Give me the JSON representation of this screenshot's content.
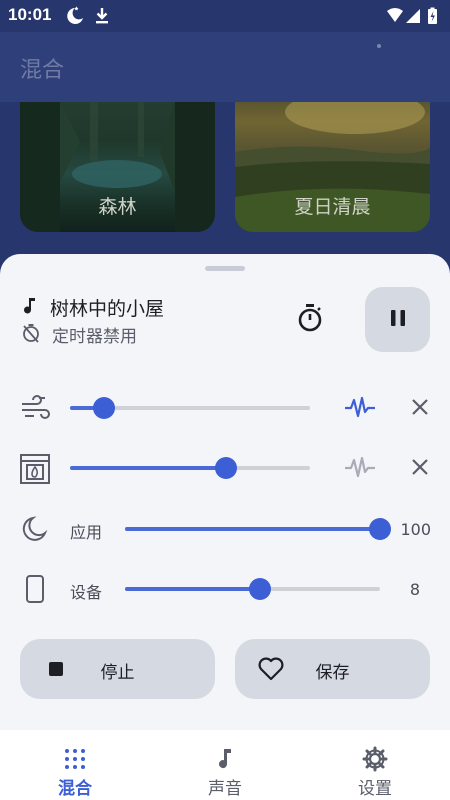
{
  "status_bar": {
    "time": "10:01",
    "icons": [
      "moon-icon",
      "download-icon",
      "wifi-icon",
      "signal-icon",
      "battery-charging-icon"
    ]
  },
  "app_bar": {
    "title": "混合"
  },
  "sound_cards": [
    {
      "label": "森林"
    },
    {
      "label": "夏日清晨"
    }
  ],
  "now_playing": {
    "title": "树林中的小屋",
    "timer_status": "定时器禁用",
    "icons": {
      "note": "music-note-icon",
      "timer_off": "timer-off-icon",
      "stopwatch": "stopwatch-icon",
      "pause": "pause-icon"
    }
  },
  "sound_mixers": [
    {
      "name": "wind",
      "icon": "wind-icon",
      "level": 0.14,
      "wave_active": true
    },
    {
      "name": "fireplace",
      "icon": "fireplace-icon",
      "level": 0.65,
      "wave_active": false
    }
  ],
  "volume_controls": [
    {
      "label": "应用",
      "icon": "moon-icon",
      "value": "100",
      "level": 1.0
    },
    {
      "label": "设备",
      "icon": "phone-icon",
      "value": "8",
      "level": 0.53
    }
  ],
  "actions": {
    "stop_label": "停止",
    "save_label": "保存"
  },
  "bottom_nav": {
    "items": [
      {
        "label": "混合",
        "icon": "grid-dots-icon",
        "active": true
      },
      {
        "label": "声音",
        "icon": "music-note-icon",
        "active": false
      },
      {
        "label": "设置",
        "icon": "gear-icon",
        "active": false
      }
    ]
  },
  "colors": {
    "accent": "#3d5fd6",
    "background": "#27376e",
    "sheet": "#f4f5f8",
    "button": "#d5d9e2"
  }
}
